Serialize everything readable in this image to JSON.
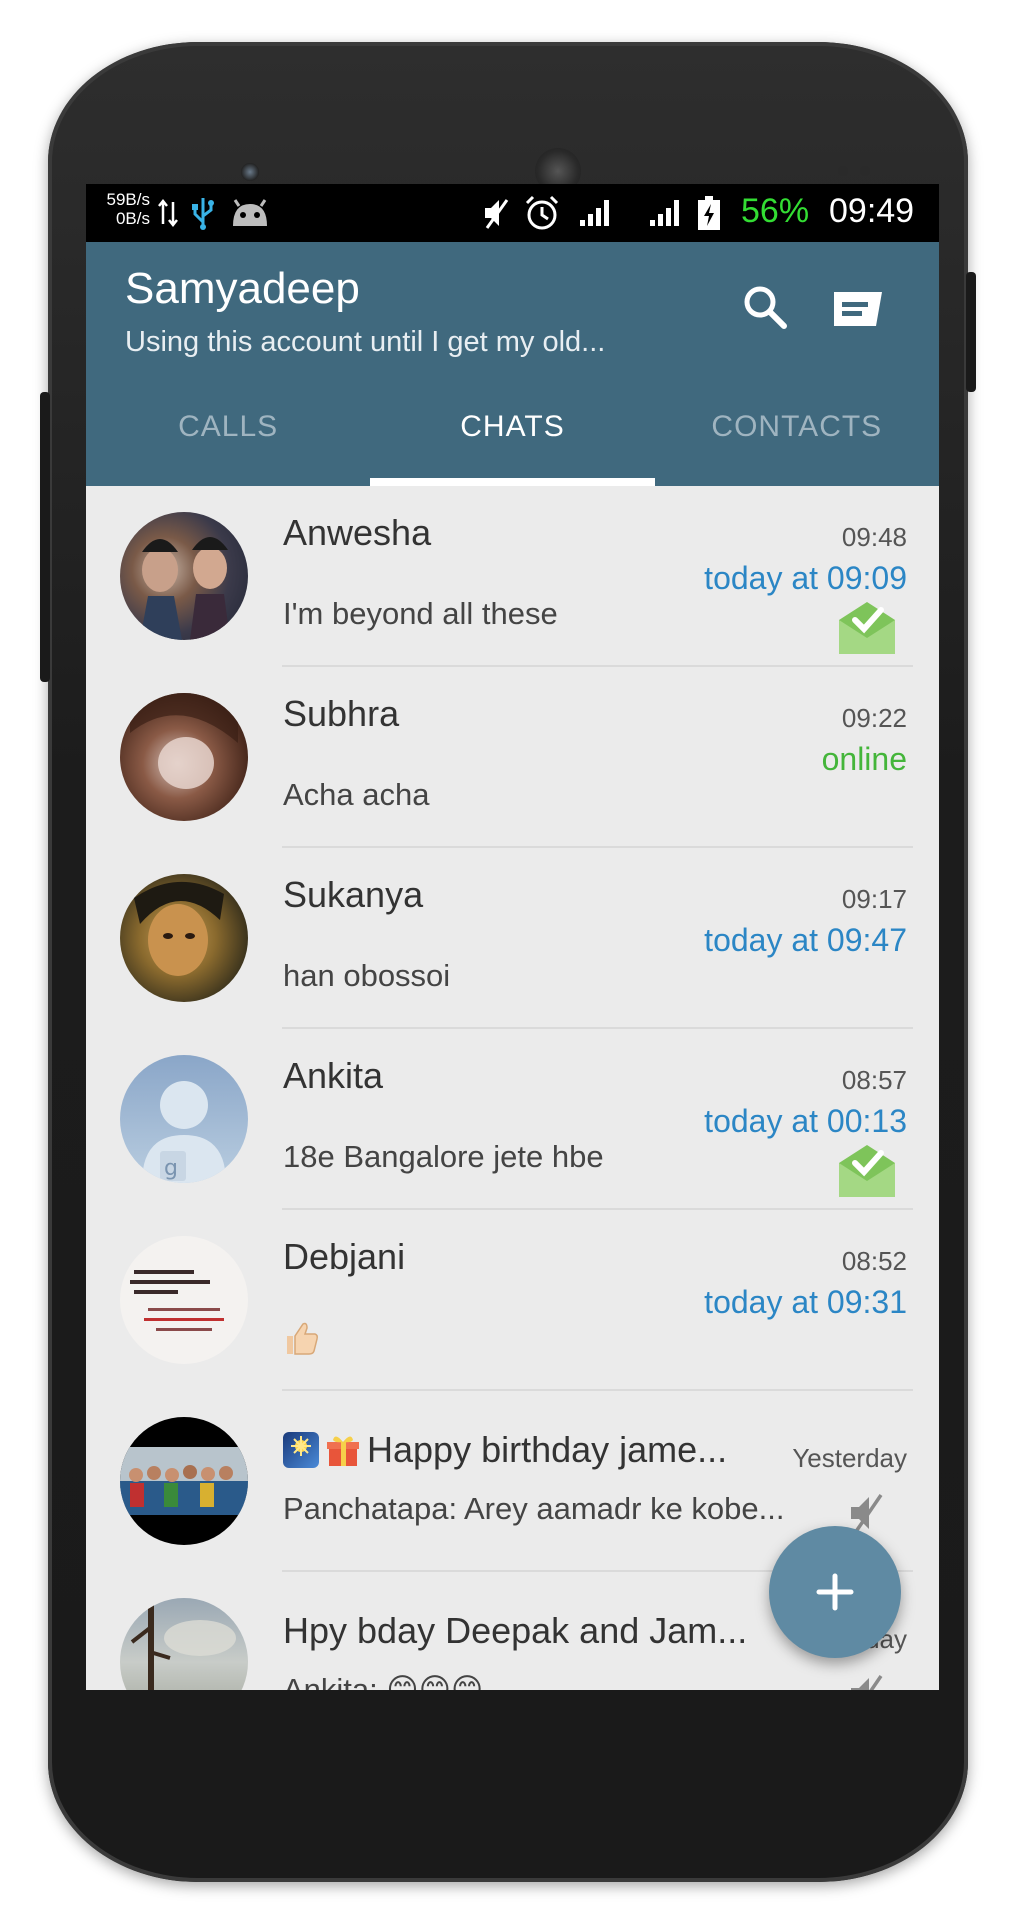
{
  "status_bar": {
    "net_up": "59B/s",
    "net_down": "0B/s",
    "battery_percent": "56%",
    "time": "09:49",
    "icons": [
      "data-transfer-icon",
      "usb-icon",
      "android-debug-icon",
      "mute-icon",
      "alarm-icon",
      "signal-icon",
      "signal-icon",
      "battery-charging-icon"
    ]
  },
  "app_bar": {
    "account_name": "Samyadeep",
    "account_status": "Using this account until I get my old...",
    "background_color": "#40697e"
  },
  "tabs": [
    {
      "label": "CALLS",
      "active": false
    },
    {
      "label": "CHATS",
      "active": true
    },
    {
      "label": "CONTACTS",
      "active": false
    }
  ],
  "chats": [
    {
      "name": "Anwesha",
      "preview": "I'm beyond all these",
      "time": "09:48",
      "last_seen": "today at 09:09",
      "read_receipt": true
    },
    {
      "name": "Subhra",
      "preview": "Acha acha",
      "time": "09:22",
      "last_seen": "online",
      "read_receipt": false
    },
    {
      "name": "Sukanya",
      "preview": "han obossoi",
      "time": "09:17",
      "last_seen": "today at 09:47",
      "read_receipt": false
    },
    {
      "name": "Ankita",
      "preview": "18e Bangalore jete hbe",
      "time": "08:57",
      "last_seen": "today at 00:13",
      "read_receipt": true
    },
    {
      "name": "Debjani",
      "preview": "👍",
      "time": "08:52",
      "last_seen": "today at 09:31",
      "read_receipt": false
    }
  ],
  "groups": [
    {
      "title": "Happy birthday jame...",
      "preview": "Panchatapa: Arey aamadr ke kobe...",
      "time": "Yesterday",
      "muted": true
    },
    {
      "title": "Hpy bday Deepak and Jam...",
      "preview": "Ankita: 😊😊😊",
      "time": "Yesterday",
      "muted": true
    }
  ],
  "fab": {
    "icon": "plus-icon"
  },
  "colors": {
    "accent_blue": "#2b86c5",
    "online_green": "#44b53a",
    "fab": "#5f8aa3"
  }
}
